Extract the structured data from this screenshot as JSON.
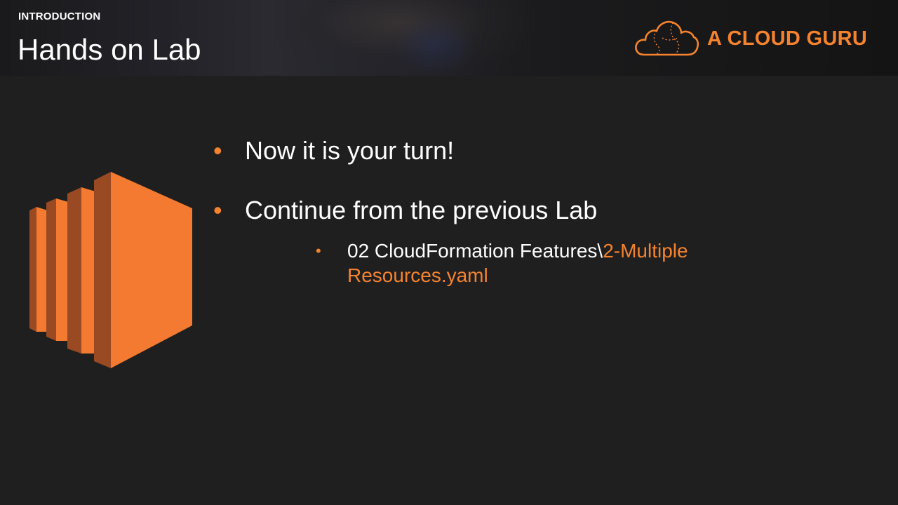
{
  "header": {
    "eyebrow": "INTRODUCTION",
    "title": "Hands on Lab"
  },
  "logo": {
    "text": "A CLOUD GURU",
    "icon": "cloud-icon"
  },
  "illustration": {
    "icon": "ec2-instance-icon"
  },
  "bullets": [
    {
      "text": "Now it is your turn!"
    },
    {
      "text": "Continue from the previous Lab"
    }
  ],
  "sub_bullet": {
    "prefix": "02 CloudFormation Features\\",
    "highlight_line1": "2-Multiple",
    "highlight_line2": "Resources.yaml"
  },
  "colors": {
    "accent": "#f5832e",
    "background": "#1f1f1f",
    "text": "#ffffff"
  }
}
